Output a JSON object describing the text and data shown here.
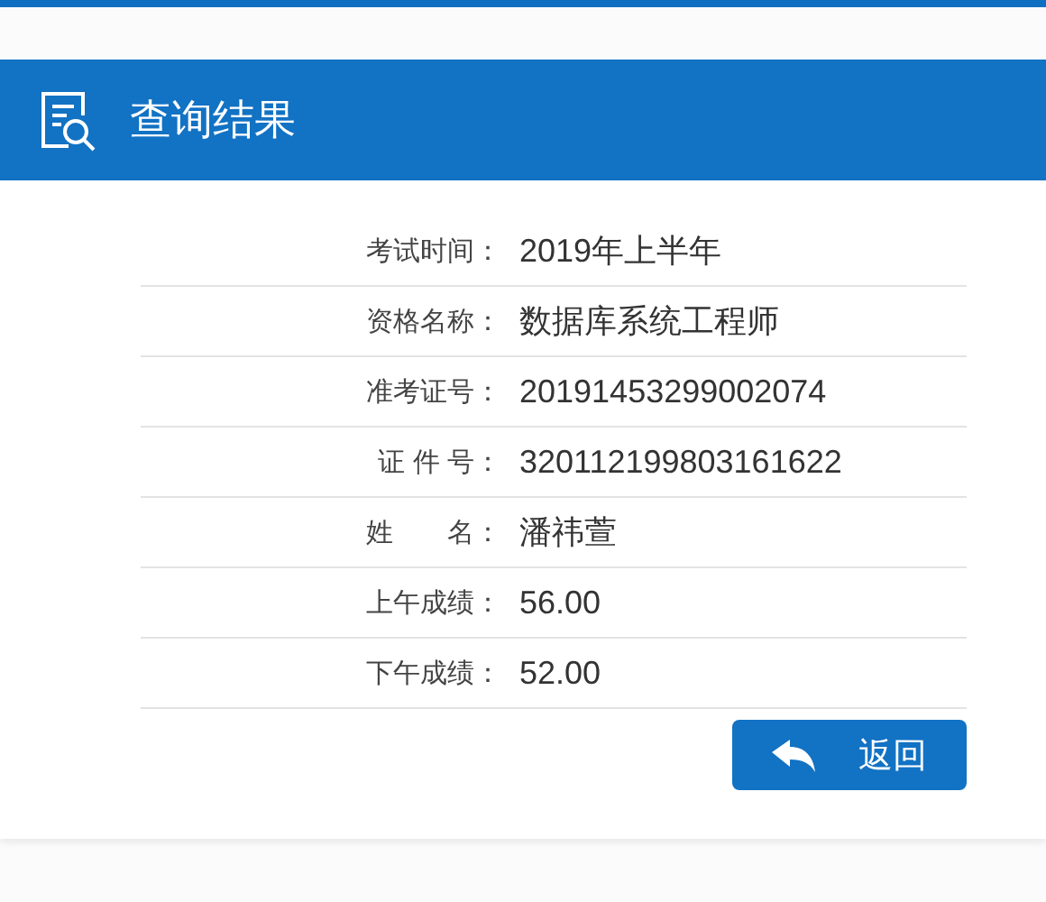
{
  "header": {
    "title": "查询结果"
  },
  "rows": [
    {
      "label": "考试时间：",
      "value": "2019年上半年"
    },
    {
      "label": "资格名称：",
      "value": "数据库系统工程师"
    },
    {
      "label": "准考证号：",
      "value": "20191453299002074"
    },
    {
      "label": "证 件 号：",
      "value": "320112199803161622"
    },
    {
      "label": "姓　　名：",
      "value": "潘祎萱"
    },
    {
      "label": "上午成绩：",
      "value": "56.00"
    },
    {
      "label": "下午成绩：",
      "value": "52.00"
    }
  ],
  "back_button": {
    "label": "返回"
  }
}
